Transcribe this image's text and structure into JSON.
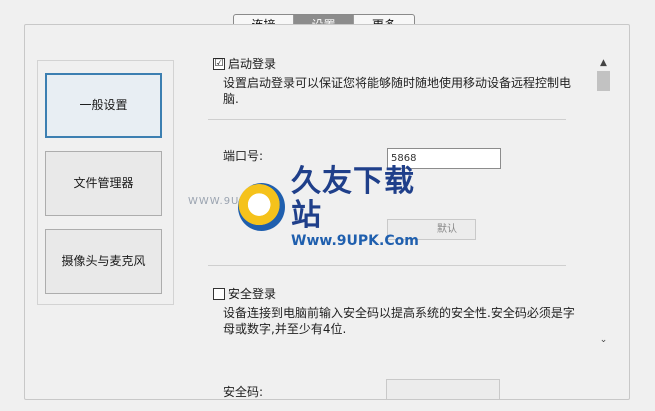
{
  "tabs": [
    {
      "label": "连接",
      "active": false
    },
    {
      "label": "设置",
      "active": true
    },
    {
      "label": "更多",
      "active": false
    }
  ],
  "nav": {
    "items": [
      {
        "label": "一般设置",
        "selected": true
      },
      {
        "label": "文件管理器",
        "selected": false
      },
      {
        "label": "摄像头与麦克风",
        "selected": false
      }
    ]
  },
  "autologin": {
    "label": "启动登录",
    "checked": true,
    "check_glyph": "☑",
    "description": "设置启动登录可以保证您将能够随时随地使用移动设备远程控制电脑."
  },
  "port": {
    "label": "端口号:",
    "value": "5868"
  },
  "hidden_field": {
    "button_fragment": "默认"
  },
  "secure_login": {
    "label": "安全登录",
    "checked": false,
    "description": "设备连接到电脑前输入安全码以提高系统的安全性.安全码必须是字母或数字,并至少有4位."
  },
  "security_code": {
    "label": "安全码:",
    "value": ""
  },
  "scrollbar": {
    "up_glyph": "▲",
    "down_glyph": "⌄"
  },
  "watermark": {
    "title": "久友下载站",
    "url": "Www.9UPK.Com",
    "small_url": "WWW.9UPK.COM",
    "logo_icon": "9upk-logo-icon"
  }
}
